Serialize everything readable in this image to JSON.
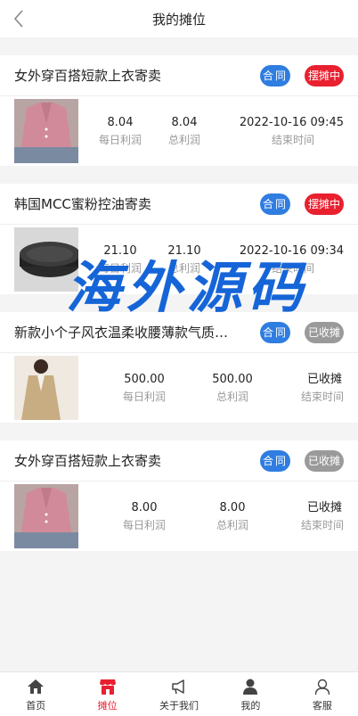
{
  "header": {
    "title": "我的摊位"
  },
  "contract_label": "合同",
  "cards": [
    {
      "title": "女外穿百搭短款上衣寄卖",
      "status": "摆摊中",
      "status_color": "#e8202f",
      "daily": "8.04",
      "daily_label": "每日利润",
      "total": "8.04",
      "total_label": "总利润",
      "end": "2022-10-16 09:45",
      "end_label": "结束时间"
    },
    {
      "title": "韩国MCC蜜粉控油寄卖",
      "status": "摆摊中",
      "status_color": "#e8202f",
      "daily": "21.10",
      "daily_label": "每日利润",
      "total": "21.10",
      "total_label": "总利润",
      "end": "2022-10-16 09:34",
      "end_label": "结束时间"
    },
    {
      "title": "新款小个子风衣温柔收腰薄款气质…",
      "status": "已收摊",
      "status_color": "#9a9a9a",
      "daily": "500.00",
      "daily_label": "每日利润",
      "total": "500.00",
      "total_label": "总利润",
      "end": "已收摊",
      "end_label": "结束时间"
    },
    {
      "title": "女外穿百搭短款上衣寄卖",
      "status": "已收摊",
      "status_color": "#9a9a9a",
      "daily": "8.00",
      "daily_label": "每日利润",
      "total": "8.00",
      "total_label": "总利润",
      "end": "已收摊",
      "end_label": "结束时间"
    }
  ],
  "watermark": "海外源码",
  "tabbar": {
    "items": [
      {
        "label": "首页",
        "icon": "home-icon"
      },
      {
        "label": "摊位",
        "icon": "stall-icon",
        "active": true
      },
      {
        "label": "关于我们",
        "icon": "megaphone-icon"
      },
      {
        "label": "我的",
        "icon": "user-icon"
      },
      {
        "label": "客服",
        "icon": "service-icon"
      }
    ]
  },
  "colors": {
    "accent_red": "#e8202f",
    "contract_blue": "#2f7de1",
    "closed_gray": "#9a9a9a"
  }
}
